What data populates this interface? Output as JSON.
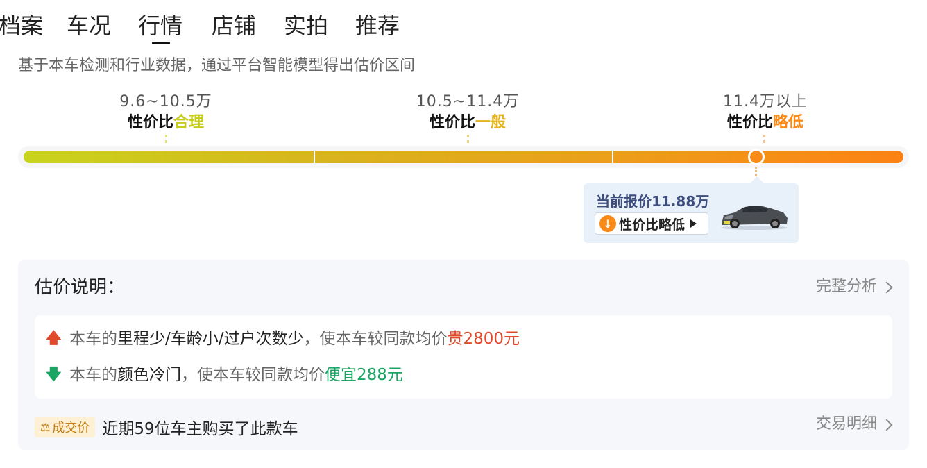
{
  "tabs": [
    {
      "label": "档案"
    },
    {
      "label": "车况"
    },
    {
      "label": "行情",
      "active": true
    },
    {
      "label": "店铺"
    },
    {
      "label": "实拍"
    },
    {
      "label": "推荐"
    }
  ],
  "description": "基于本车检测和行业数据，通过平台智能模型得出估价区间",
  "ranges": [
    {
      "price": "9.6~10.5万",
      "prefix": "性价比",
      "level": "合理",
      "color": "#c5cc1c"
    },
    {
      "price": "10.5~11.4万",
      "prefix": "性价比",
      "level": "一般",
      "color": "#e5b31b"
    },
    {
      "price": "11.4万以上",
      "prefix": "性价比",
      "level": "略低",
      "color": "#f98a18"
    }
  ],
  "current_price_fraction_on_bar": 0.83,
  "callout": {
    "current_price": "当前报价11.88万",
    "button_label": "性价比略低",
    "icon": "arrow-down-circle-icon",
    "image": "car-thumbnail"
  },
  "card": {
    "title": "估价说明：",
    "full_analysis_link": "完整分析",
    "reasons": [
      {
        "direction": "up",
        "icon": "arrow-up-icon",
        "color": "#e04a2a",
        "prefix": "本车的",
        "factor": "里程少/车龄小/过户次数少",
        "middle": "，使本车较同款均价",
        "effect": "贵2800元"
      },
      {
        "direction": "down",
        "icon": "arrow-down-icon",
        "color": "#1aa563",
        "prefix": "本车的",
        "factor": "颜色冷门",
        "middle": "，使本车较同款均价",
        "effect": "便宜288元"
      }
    ],
    "deal_badge": "成交价",
    "deal_text": "近期59位车主购买了此款车",
    "deal_link": "交易明细"
  }
}
